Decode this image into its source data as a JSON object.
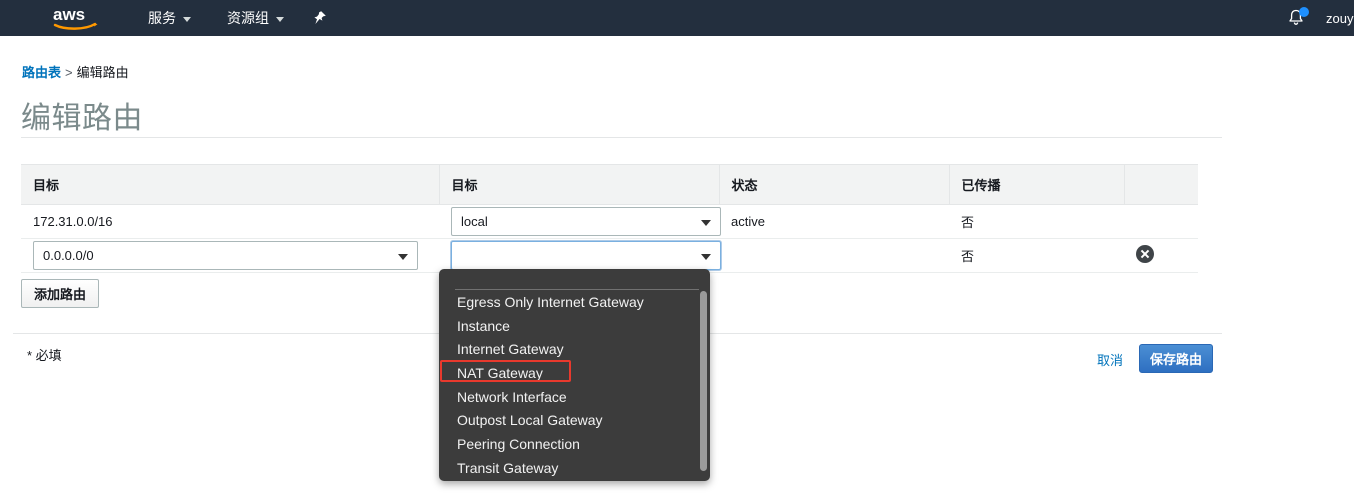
{
  "topnav": {
    "logo_alt": "aws",
    "services_label": "服务",
    "resource_groups_label": "资源组",
    "pin_icon": "pin-icon",
    "bell_icon": "bell-icon",
    "user_name": "zouy",
    "background_color": "#232f3e"
  },
  "breadcrumb": {
    "parent": "路由表",
    "separator": ">",
    "current": "编辑路由",
    "link_color": "#0073bb"
  },
  "page": {
    "title": "编辑路由"
  },
  "table": {
    "headers": [
      "目标",
      "目标",
      "状态",
      "已传播",
      ""
    ],
    "rows": [
      {
        "destination": "172.31.0.0/16",
        "target": "local",
        "status": "active",
        "status_color": "#1d8102",
        "propagated": "否",
        "removable": false
      },
      {
        "destination": "0.0.0.0/0",
        "target": "",
        "status": "",
        "propagated": "否",
        "removable": true,
        "remove_icon": "close-circle-icon"
      }
    ]
  },
  "buttons": {
    "add_route": "添加路由",
    "cancel": "取消",
    "save": "保存路由",
    "save_color": "#2e6fc1"
  },
  "footer": {
    "required_note": "* 必填"
  },
  "dropdown": {
    "open": true,
    "items": [
      "Egress Only Internet Gateway",
      "Instance",
      "Internet Gateway",
      "NAT Gateway",
      "Network Interface",
      "Outpost Local Gateway",
      "Peering Connection",
      "Transit Gateway"
    ],
    "highlighted_item": "NAT Gateway",
    "highlight_color": "#e8392d",
    "background_color": "#3c3c3c"
  }
}
